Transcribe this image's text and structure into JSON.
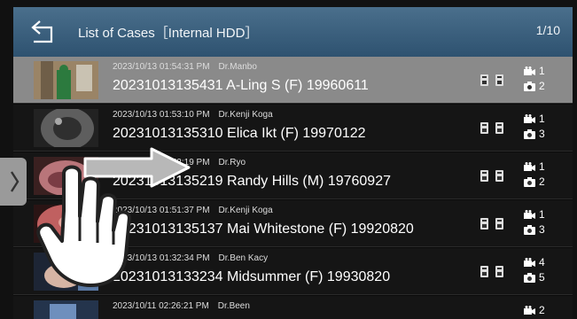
{
  "header": {
    "title": "List of Cases［Internal HDD］",
    "page_indicator": "1/10"
  },
  "cases": [
    {
      "datetime": "2023/10/13 01:54:31 PM",
      "doctor": "Dr.Manbo",
      "name": "20231013135431 A-Ling S (F) 19960611",
      "videos": "1",
      "photos": "2",
      "selected": true
    },
    {
      "datetime": "2023/10/13 01:53:10 PM",
      "doctor": "Dr.Kenji Koga",
      "name": "20231013135310 Elica Ikt (F) 19970122",
      "videos": "1",
      "photos": "3"
    },
    {
      "datetime": "2023/10/13 01:52:19 PM",
      "doctor": "Dr.Ryo",
      "name": "20231013135219 Randy Hills (M) 19760927",
      "videos": "1",
      "photos": "2"
    },
    {
      "datetime": "2023/10/13 01:51:37 PM",
      "doctor": "Dr.Kenji Koga",
      "name": "20231013135137 Mai Whitestone (F) 19920820",
      "videos": "1",
      "photos": "3"
    },
    {
      "datetime": "2023/10/13 01:32:34 PM",
      "doctor": "Dr.Ben Kacy",
      "name": "20231013133234 Midsummer (F) 19930820",
      "videos": "4",
      "photos": "5"
    },
    {
      "datetime": "2023/10/11 02:26:21 PM",
      "doctor": "Dr.Been",
      "name": "",
      "videos": "2",
      "photos": ""
    }
  ],
  "colors": {
    "header": "#3d6482",
    "selected_row": "#8a8a8a",
    "row": "#151515"
  }
}
